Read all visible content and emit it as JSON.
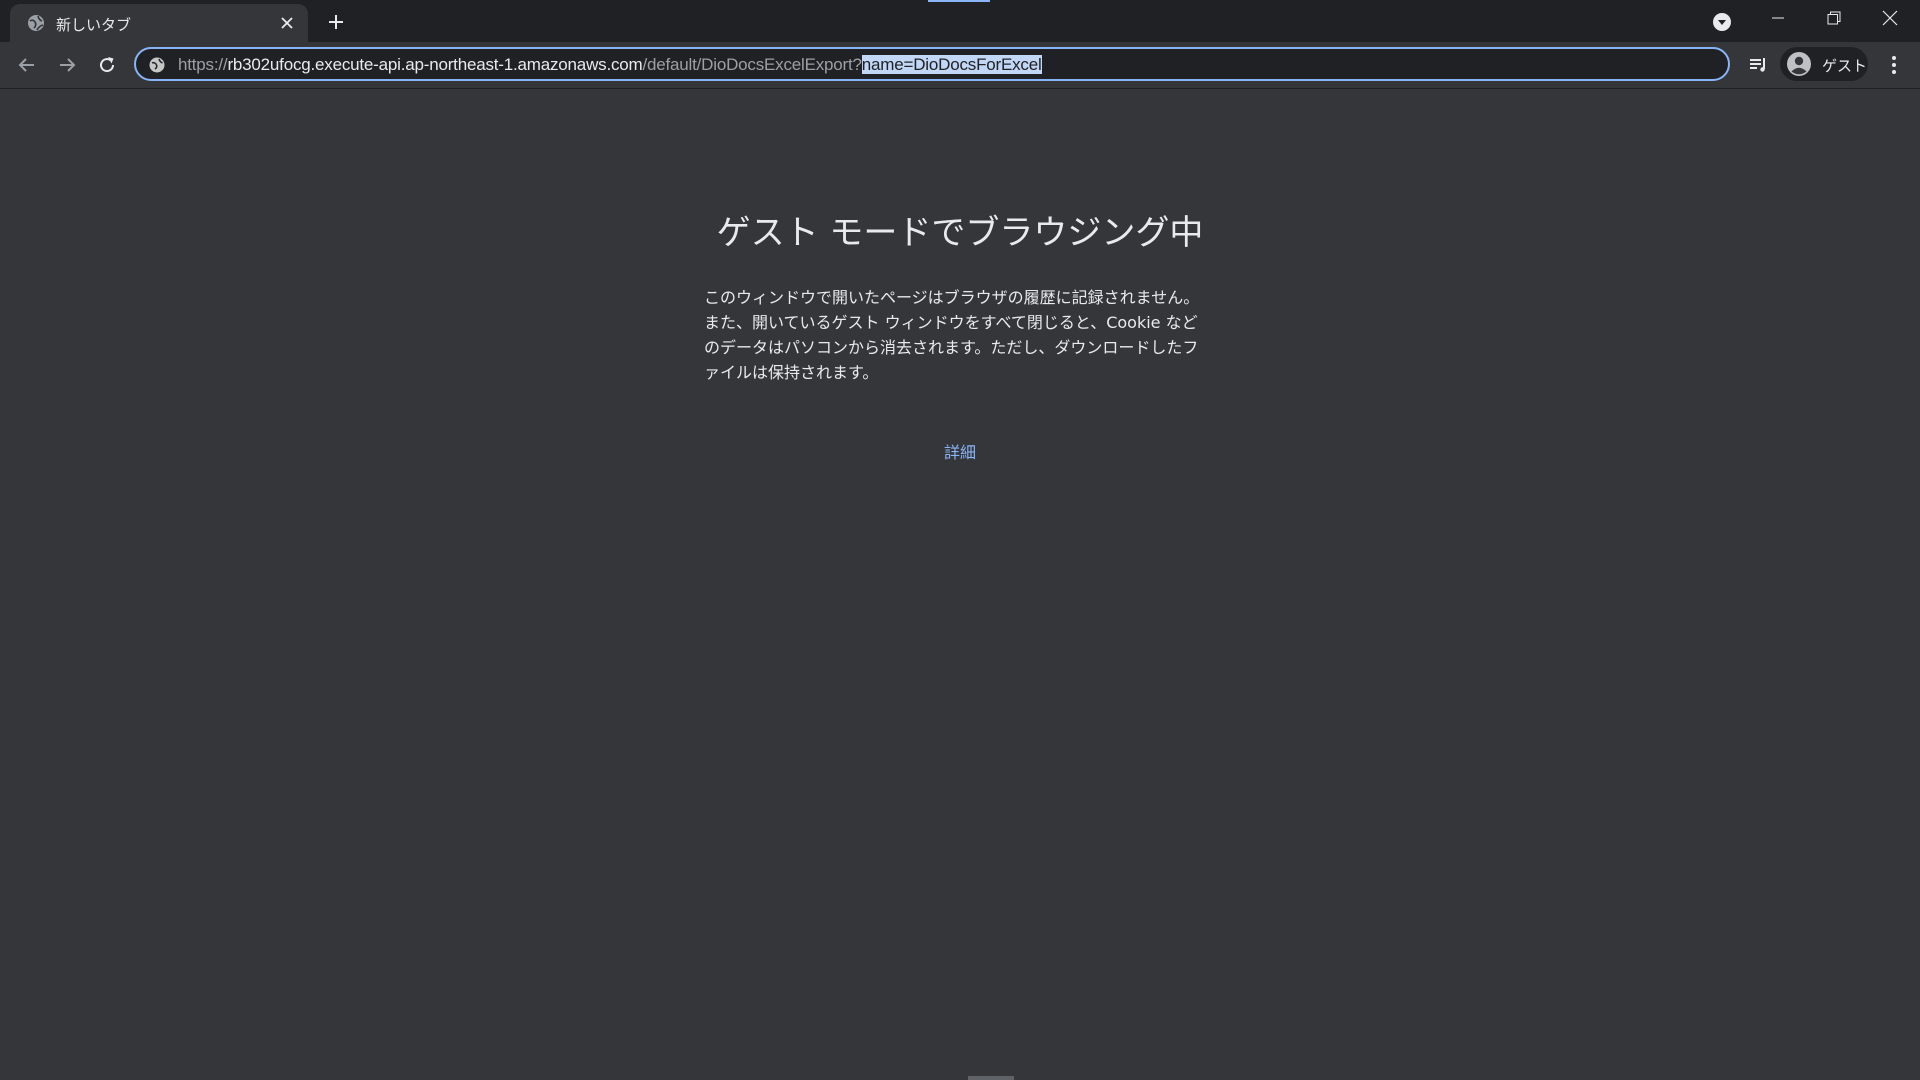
{
  "tab": {
    "title": "新しいタブ"
  },
  "omnibox": {
    "url_scheme": "https://",
    "url_host": "rb302ufocg.execute-api.ap-northeast-1.amazonaws.com",
    "url_path": "/default/DioDocsExcelExport?",
    "url_selected": "name=DioDocsForExcel"
  },
  "profile": {
    "label": "ゲスト"
  },
  "page": {
    "heading": "ゲスト モードでブラウジング中",
    "description": "このウィンドウで開いたページはブラウザの履歴に記録されません。また、開いているゲスト ウィンドウをすべて閉じると、Cookie などのデータはパソコンから消去されます。ただし、ダウンロードしたファイルは保持されます。",
    "learn_more": "詳細"
  },
  "colors": {
    "background": "#35363a",
    "titlebar": "#202124",
    "accent": "#8ab4f8",
    "text": "#e8eaed"
  },
  "icons": [
    "globe-icon",
    "close-icon",
    "plus-icon",
    "tab-search-icon",
    "minimize-icon",
    "restore-icon",
    "back-arrow-icon",
    "forward-arrow-icon",
    "reload-icon",
    "site-info-icon",
    "reading-list-icon",
    "account-circle-icon",
    "kebab-menu-icon"
  ]
}
